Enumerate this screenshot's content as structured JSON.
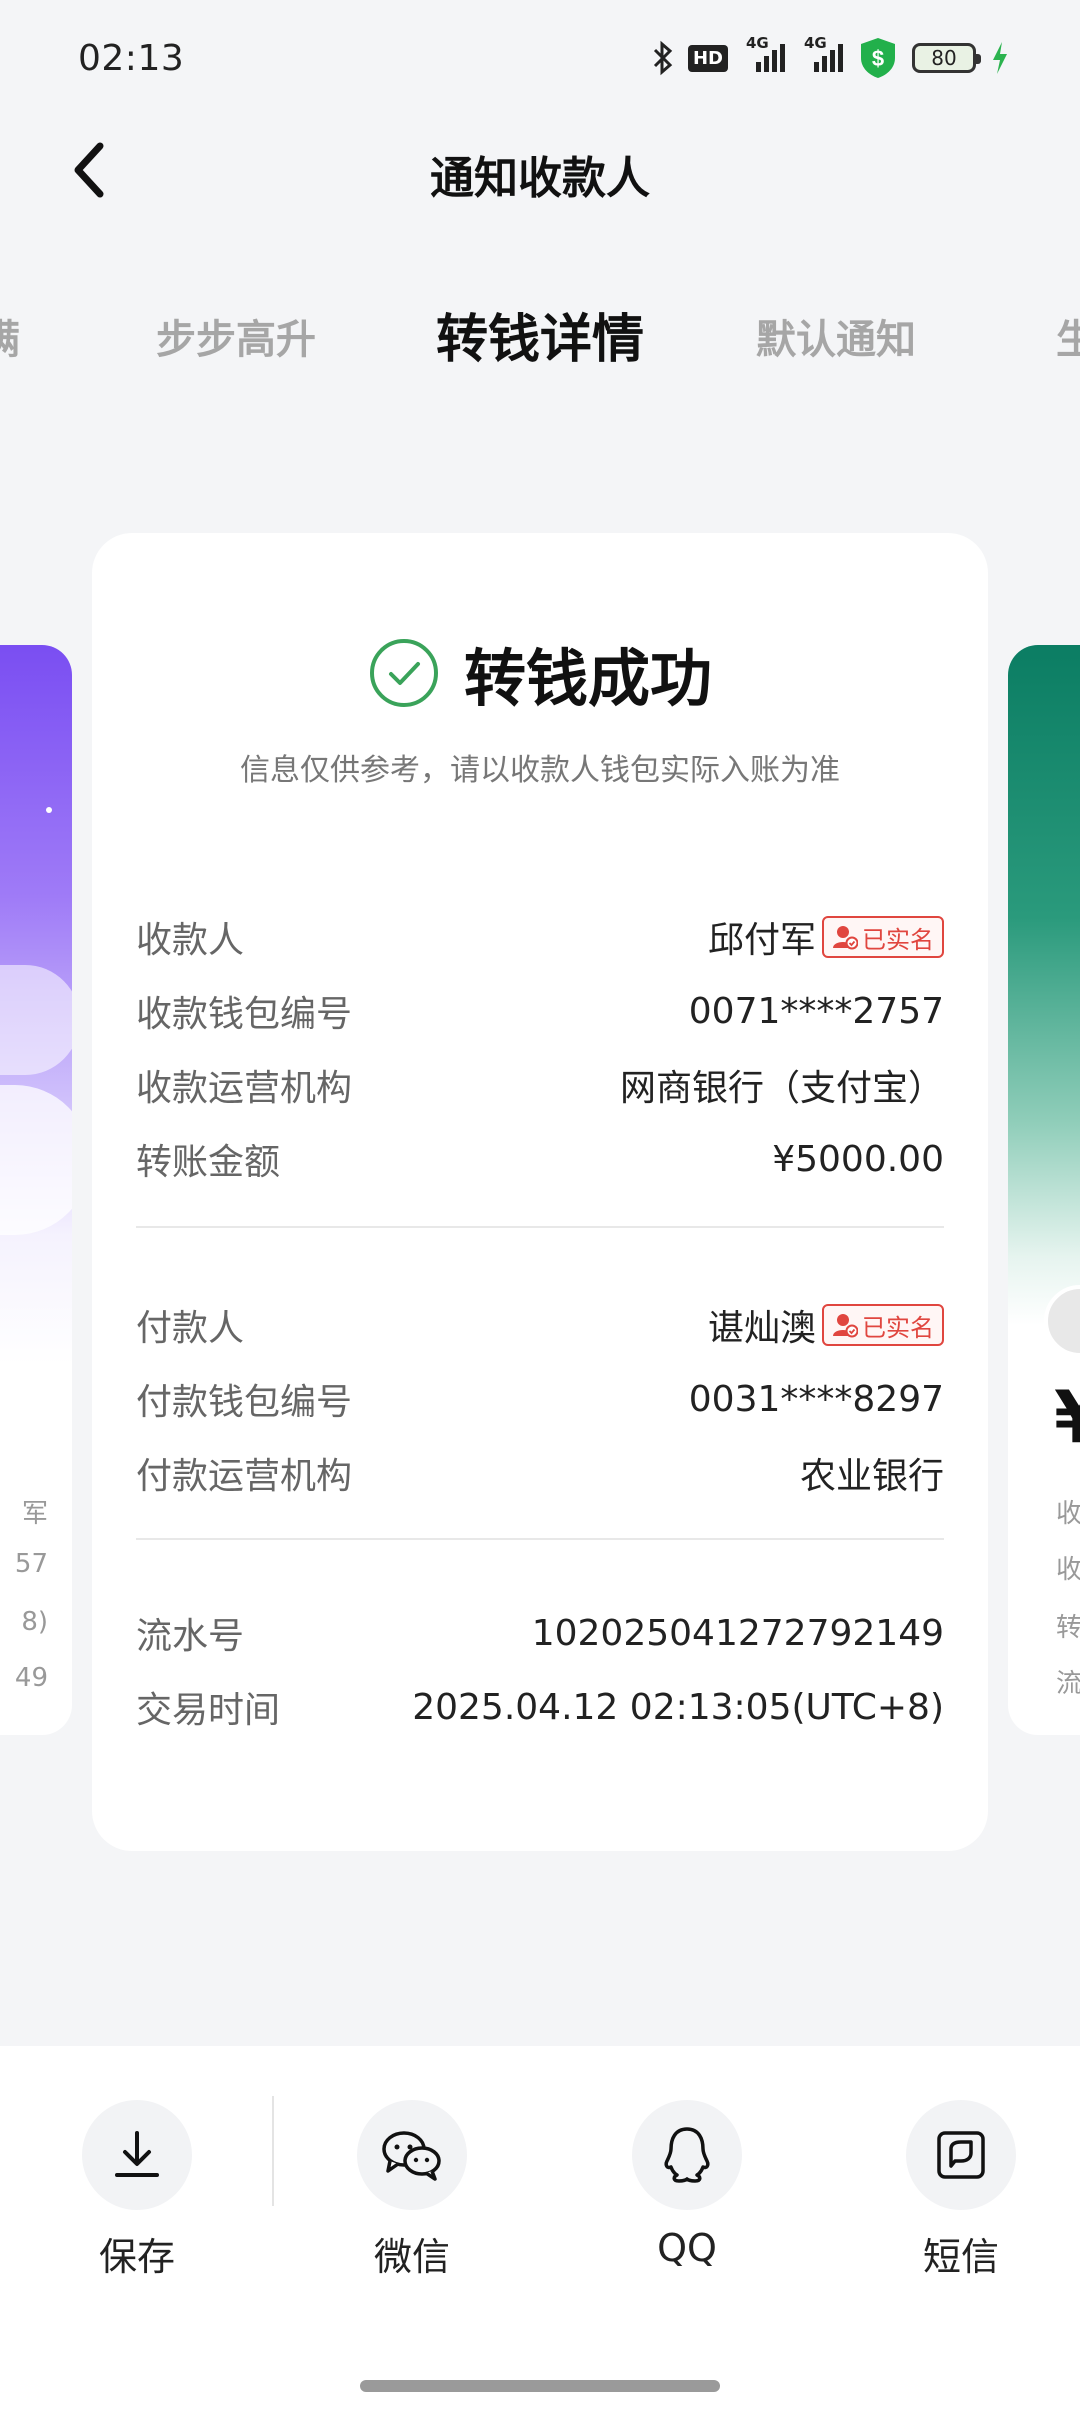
{
  "status_bar": {
    "time": "02:13",
    "hd_label": "HD",
    "net1": "4G",
    "net2": "4G",
    "battery": "80"
  },
  "header": {
    "title": "通知收款人"
  },
  "tabs": [
    {
      "label": "满"
    },
    {
      "label": "步步高升"
    },
    {
      "label": "转钱详情"
    },
    {
      "label": "默认通知"
    },
    {
      "label": "生"
    }
  ],
  "left_peek": [
    "军",
    "57",
    "8)",
    "49"
  ],
  "right_peek": {
    "currency": "¥",
    "lines": [
      "收",
      "收",
      "转",
      "流"
    ]
  },
  "card": {
    "status_title": "转钱成功",
    "status_note": "信息仅供参考，请以收款人钱包实际入账为准",
    "badge": "已实名",
    "payee_rows": [
      {
        "label": "收款人",
        "value": "邱付军"
      },
      {
        "label": "收款钱包编号",
        "value": "0071****2757"
      },
      {
        "label": "收款运营机构",
        "value": "网商银行（支付宝）"
      },
      {
        "label": "转账金额",
        "value": "¥5000.00"
      }
    ],
    "payer_rows": [
      {
        "label": "付款人",
        "value": "谌灿澳"
      },
      {
        "label": "付款钱包编号",
        "value": "0031****8297"
      },
      {
        "label": "付款运营机构",
        "value": "农业银行"
      }
    ],
    "meta_rows": [
      {
        "label": "流水号",
        "value": "102025041272792149"
      },
      {
        "label": "交易时间",
        "value": "2025.04.12 02:13:05(UTC+8)"
      }
    ]
  },
  "share": [
    {
      "label": "保存",
      "icon": "download-icon"
    },
    {
      "label": "微信",
      "icon": "wechat-icon"
    },
    {
      "label": "QQ",
      "icon": "qq-icon"
    },
    {
      "label": "短信",
      "icon": "sms-icon"
    }
  ],
  "colors": {
    "success": "#3aa35a",
    "badge": "#e0463f",
    "shield": "#22b04b"
  }
}
